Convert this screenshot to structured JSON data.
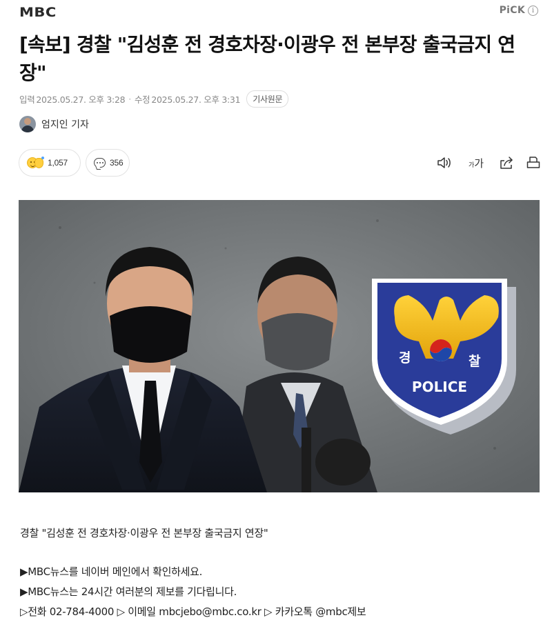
{
  "header": {
    "press_name": "MBC",
    "pick_label": "PiCK",
    "info_glyph": "i"
  },
  "article": {
    "title": "[속보] 경찰 \"김성훈 전 경호차장·이광우 전 본부장 출국금지 연장\"",
    "input_label": "입력",
    "input_time": "2025.05.27. 오후 3:28",
    "modify_label": "수정",
    "modify_time": "2025.05.27. 오후 3:31",
    "original_link": "기사원문",
    "reporter": "엄지인 기자"
  },
  "actions": {
    "reaction_count": "1,057",
    "comment_count": "356",
    "font_small": "가",
    "font_big": "가",
    "icons": [
      "smile-emoji-icon",
      "comment-icon",
      "speaker-icon",
      "font-size-icon",
      "share-icon",
      "print-icon"
    ]
  },
  "photo": {
    "badge_left": "경",
    "badge_right": "찰",
    "badge_text": "POLICE",
    "colors": {
      "wall": "#6e7274",
      "badge_blue": "#2a3c9a",
      "badge_gold": "#f2b517"
    }
  },
  "body": {
    "caption": "경찰 \"김성훈 전 경호차장·이광우 전 본부장 출국금지 연장\"",
    "promo_1": "▶MBC뉴스를 네이버 메인에서 확인하세요.",
    "promo_2": "▶MBC뉴스는 24시간 여러분의 제보를 기다립니다.",
    "tip_phone": "▷전화 02-784-4000",
    "tip_email_sep": " ▷ 이메일 ",
    "tip_email": "mbcjebo@mbc.co.kr",
    "tip_kakao_sep": " ▷ 카카오톡 ",
    "tip_kakao": "@mbc제보"
  }
}
